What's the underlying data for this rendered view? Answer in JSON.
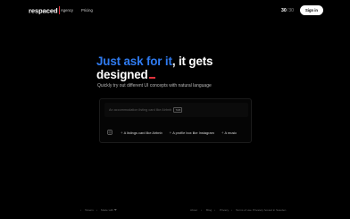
{
  "header": {
    "logo": "respaced",
    "nav": [
      {
        "label": "Agency"
      },
      {
        "label": "Pricing"
      }
    ],
    "credits": {
      "used": "30",
      "separator": "/",
      "total": "30"
    },
    "signin_label": "Sign in"
  },
  "hero": {
    "title_highlight": "Just ask for it",
    "title_rest_line1": ", it gets",
    "title_line2": "designed",
    "subtitle": "Quickly try out different UI concepts with natural language"
  },
  "prompt": {
    "placeholder": "An accommodation listing card like Airbnb",
    "tab_hint": "TAB",
    "suggestions": [
      {
        "label": "A listings card like Airbnb"
      },
      {
        "label": "A profile box like Instagram"
      },
      {
        "label": "A music"
      }
    ]
  },
  "footer": {
    "left": [
      "Tokens",
      "Made with ❤"
    ],
    "right": [
      "About",
      "Blog",
      "Privacy",
      "Terms of use",
      "Privately hosted in Sweden"
    ]
  },
  "colors": {
    "background": "#000000",
    "accent": "#2f7bf0",
    "cursor": "#e0323c"
  }
}
